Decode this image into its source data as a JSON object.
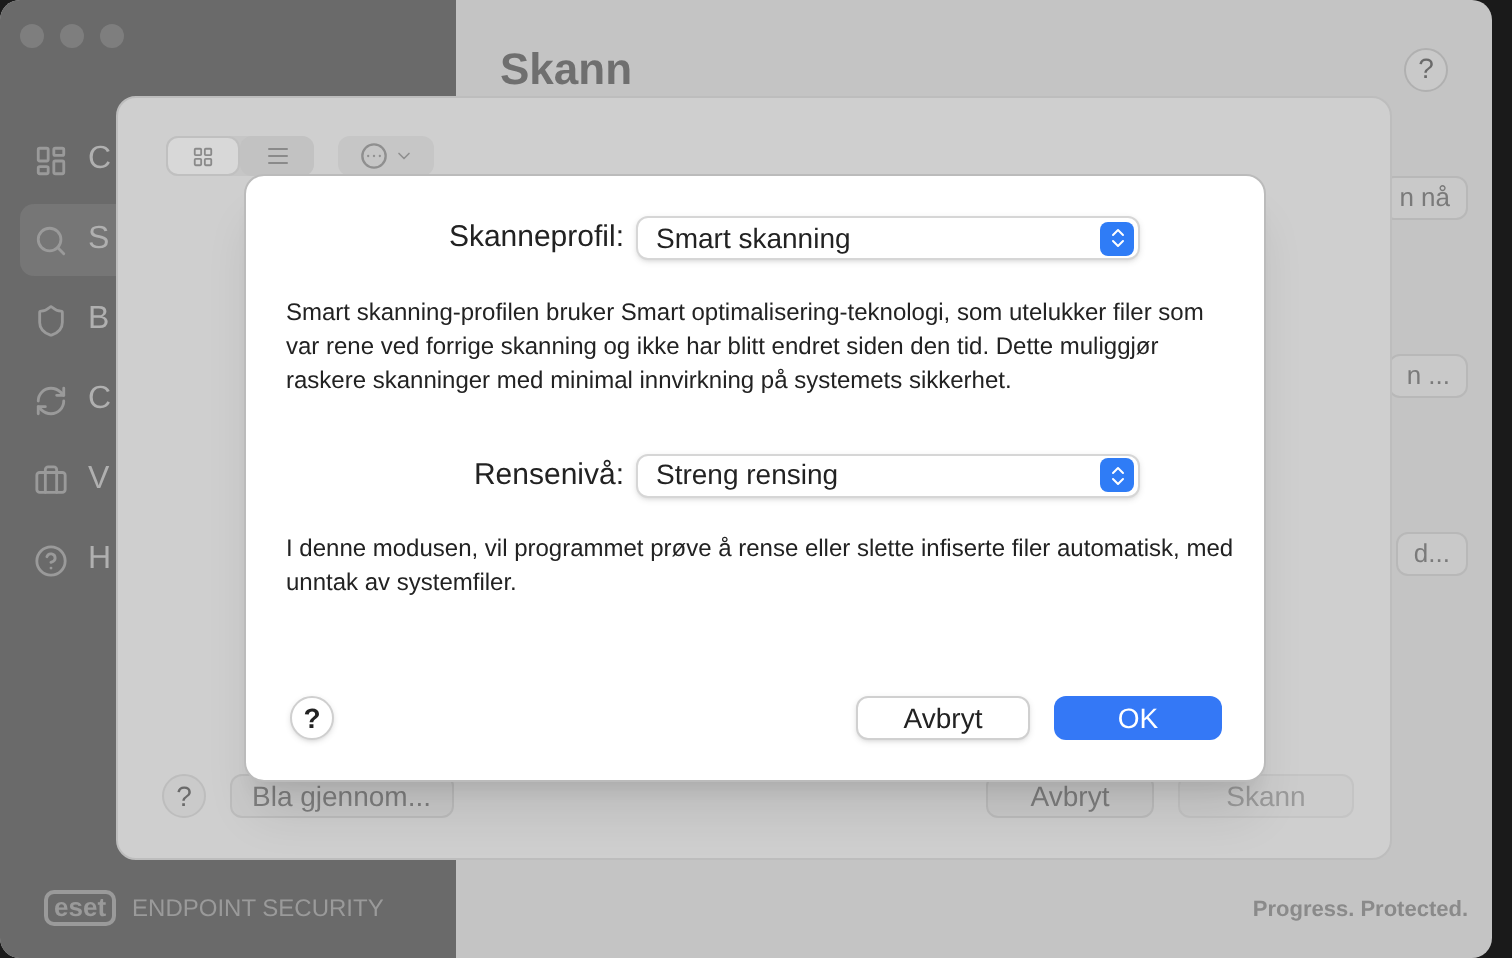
{
  "app": {
    "title": "Skann",
    "help_button": "?",
    "sidebar_items": [
      {
        "label": "C",
        "selected": false
      },
      {
        "label": "S",
        "selected": true
      },
      {
        "label": "B",
        "selected": false
      },
      {
        "label": "C",
        "selected": false
      },
      {
        "label": "V",
        "selected": false
      },
      {
        "label": "H",
        "selected": false
      }
    ],
    "side_buttons": [
      "n nå",
      "n ...",
      "d..."
    ],
    "logo": "eset",
    "brand": "ENDPOINT SECURITY",
    "tagline": "Progress. Protected."
  },
  "sheet": {
    "view_toggle": [
      {
        "kind": "grid",
        "selected": true
      },
      {
        "kind": "list",
        "selected": false
      }
    ],
    "help_button": "?",
    "browse_button": "Bla gjennom...",
    "cancel_button": {
      "label": "Avbryt",
      "disabled": false
    },
    "scan_button": {
      "label": "Skann",
      "disabled": true
    }
  },
  "dialog": {
    "settings": [
      {
        "label": "Skanneprofil:",
        "value": "Smart skanning",
        "description": "Smart skanning-profilen bruker Smart optimalisering-teknologi, som utelukker filer som var rene ved forrige skanning og ikke har blitt endret siden den tid. Dette muliggjør raskere skanninger med minimal innvirkning på systemets sikkerhet."
      },
      {
        "label": "Rensenivå:",
        "value": "Streng rensing",
        "description": "I denne modusen, vil programmet prøve å rense eller slette infiserte filer automatisk, med unntak av systemfiler."
      }
    ],
    "help_button": "?",
    "cancel_button": "Avbryt",
    "ok_button": "OK"
  }
}
